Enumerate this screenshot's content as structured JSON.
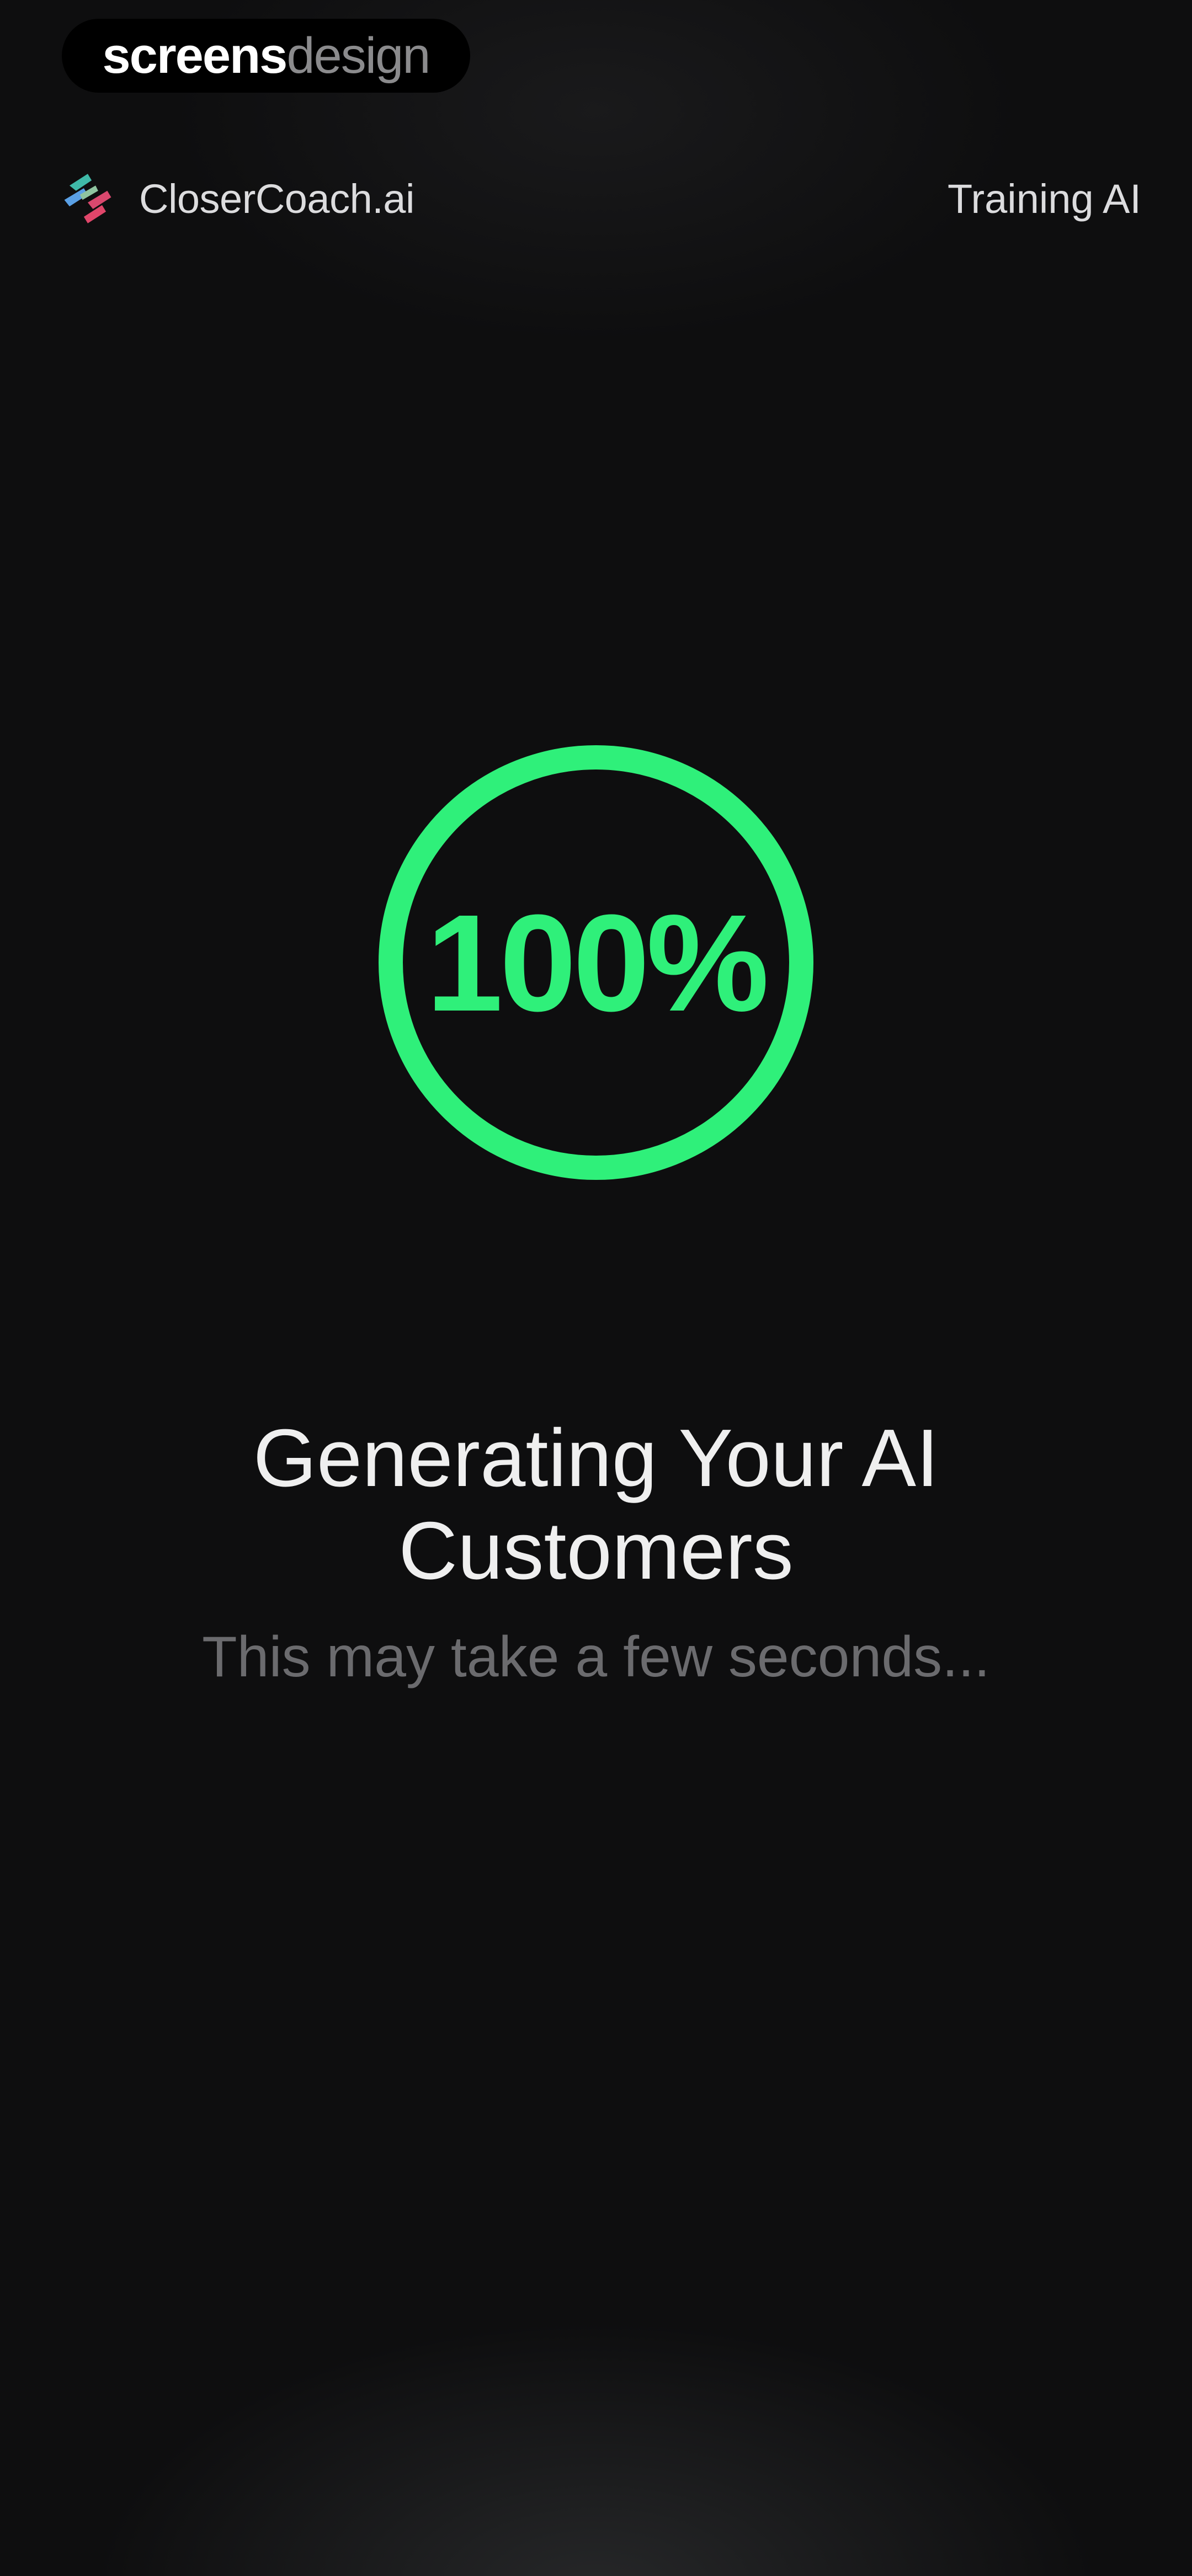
{
  "watermark": {
    "part_bold": "screens",
    "part_light": "design"
  },
  "header": {
    "brand_name": "CloserCoach.ai",
    "logo_icon": "closercoach-logo-icon",
    "nav_link": "Training AI"
  },
  "progress": {
    "label": "100%",
    "value_percent": 100,
    "color": "#2ff07a"
  },
  "status": {
    "title": "Generating Your AI Customers",
    "subtitle": "This may take a few seconds..."
  },
  "colors": {
    "background": "#0e0e0f",
    "accent": "#2ff07a",
    "muted_text": "#6b6b6e"
  }
}
